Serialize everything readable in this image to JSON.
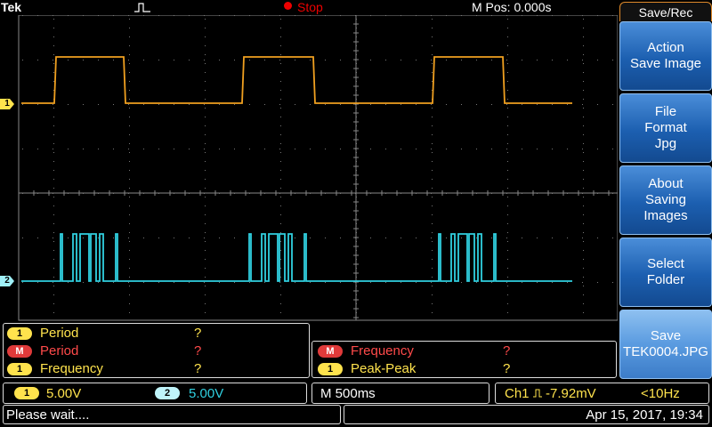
{
  "top": {
    "brand": "Tek",
    "run_state": "Stop",
    "mpos": "M Pos: 0.000s"
  },
  "colors": {
    "ch1": "#f0a020",
    "ch2": "#30d0e0",
    "menu_header_border": "#e08a2a",
    "stop": "#ee0000"
  },
  "channel_markers": {
    "ch1": "1",
    "ch2": "2"
  },
  "menu": {
    "title": "Save/Rec",
    "items": [
      {
        "label": "Action\nSave Image"
      },
      {
        "label": "File\nFormat\nJpg"
      },
      {
        "label": "About\nSaving\nImages"
      },
      {
        "label": "Select\nFolder"
      },
      {
        "label": "Save\nTEK0004.JPG"
      }
    ]
  },
  "measurements": {
    "left": [
      {
        "badge": "1",
        "name": "Period",
        "value": "?"
      },
      {
        "badge": "M",
        "name": "Period",
        "value": "?"
      },
      {
        "badge": "1",
        "name": "Frequency",
        "value": "?"
      }
    ],
    "right": [
      {
        "badge": "M",
        "name": "Frequency",
        "value": "?"
      },
      {
        "badge": "1",
        "name": "Peak-Peak",
        "value": "?"
      }
    ]
  },
  "scale": {
    "ch1_badge": "1",
    "ch1_scale": "5.00V",
    "ch2_badge": "2",
    "ch2_scale": "5.00V",
    "timebase": "M 500ms",
    "trigger": "Ch1",
    "trigger_level": "-7.92mV",
    "trigger_freq": "<10Hz"
  },
  "status": {
    "message": "Please wait....",
    "datetime": "Apr 15, 2017, 19:34"
  }
}
